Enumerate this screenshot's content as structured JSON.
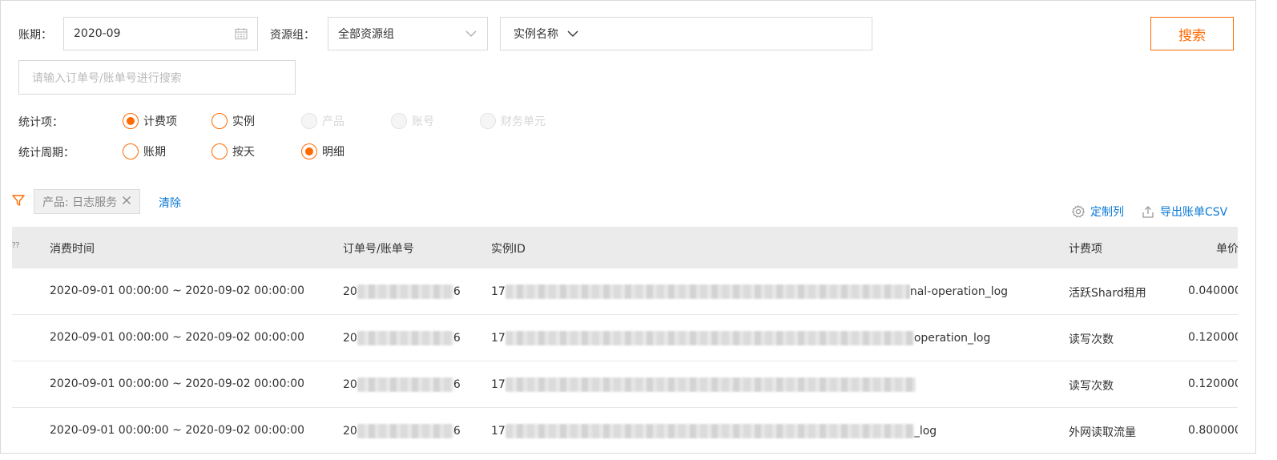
{
  "filters": {
    "period_label": "账期：",
    "period_value": "2020-09",
    "resource_group_label": "资源组：",
    "resource_group_value": "全部资源组",
    "instance_name_select": "实例名称",
    "instance_name_value": "",
    "search_button": "搜索",
    "order_search_placeholder": "请输入订单号/账单号进行搜索"
  },
  "stat_items": {
    "label": "统计项：",
    "options": [
      {
        "label": "计费项",
        "checked": true,
        "disabled": false
      },
      {
        "label": "实例",
        "checked": false,
        "disabled": false
      },
      {
        "label": "产品",
        "checked": false,
        "disabled": true
      },
      {
        "label": "账号",
        "checked": false,
        "disabled": true
      },
      {
        "label": "财务单元",
        "checked": false,
        "disabled": true
      }
    ]
  },
  "stat_period": {
    "label": "统计周期：",
    "options": [
      {
        "label": "账期",
        "checked": false
      },
      {
        "label": "按天",
        "checked": false
      },
      {
        "label": "明细",
        "checked": true
      }
    ]
  },
  "active_filter": {
    "tag": "产品: 日志服务",
    "clear": "清除"
  },
  "toolbar": {
    "customize_columns": "定制列",
    "export_csv": "导出账单CSV"
  },
  "table": {
    "columns": [
      "消费时间",
      "订单号/账单号",
      "实例ID",
      "计费项",
      "单价"
    ],
    "rows": [
      {
        "time": "2020-09-01 00:00:00  ~  2020-09-02 00:00:00",
        "order_prefix": "20",
        "order_suffix": "6",
        "instance_prefix": "17",
        "instance_suffix": "nal-operation_log",
        "billing_item": "活跃Shard租用",
        "unit_price": "0.040000"
      },
      {
        "time": "2020-09-01 00:00:00  ~  2020-09-02 00:00:00",
        "order_prefix": "20",
        "order_suffix": "6",
        "instance_prefix": "17",
        "instance_suffix": "operation_log",
        "billing_item": "读写次数",
        "unit_price": "0.120000"
      },
      {
        "time": "2020-09-01 00:00:00  ~  2020-09-02 00:00:00",
        "order_prefix": "20",
        "order_suffix": "6",
        "instance_prefix": "17",
        "instance_suffix": "",
        "billing_item": "读写次数",
        "unit_price": "0.120000"
      },
      {
        "time": "2020-09-01 00:00:00  ~  2020-09-02 00:00:00",
        "order_prefix": "20",
        "order_suffix": "6",
        "instance_prefix": "17",
        "instance_suffix": "_log",
        "billing_item": "外网读取流量",
        "unit_price": "0.800000"
      }
    ]
  },
  "colors": {
    "accent": "#ff6a00",
    "link": "#0a79d6",
    "header_bg": "#ebebeb"
  }
}
